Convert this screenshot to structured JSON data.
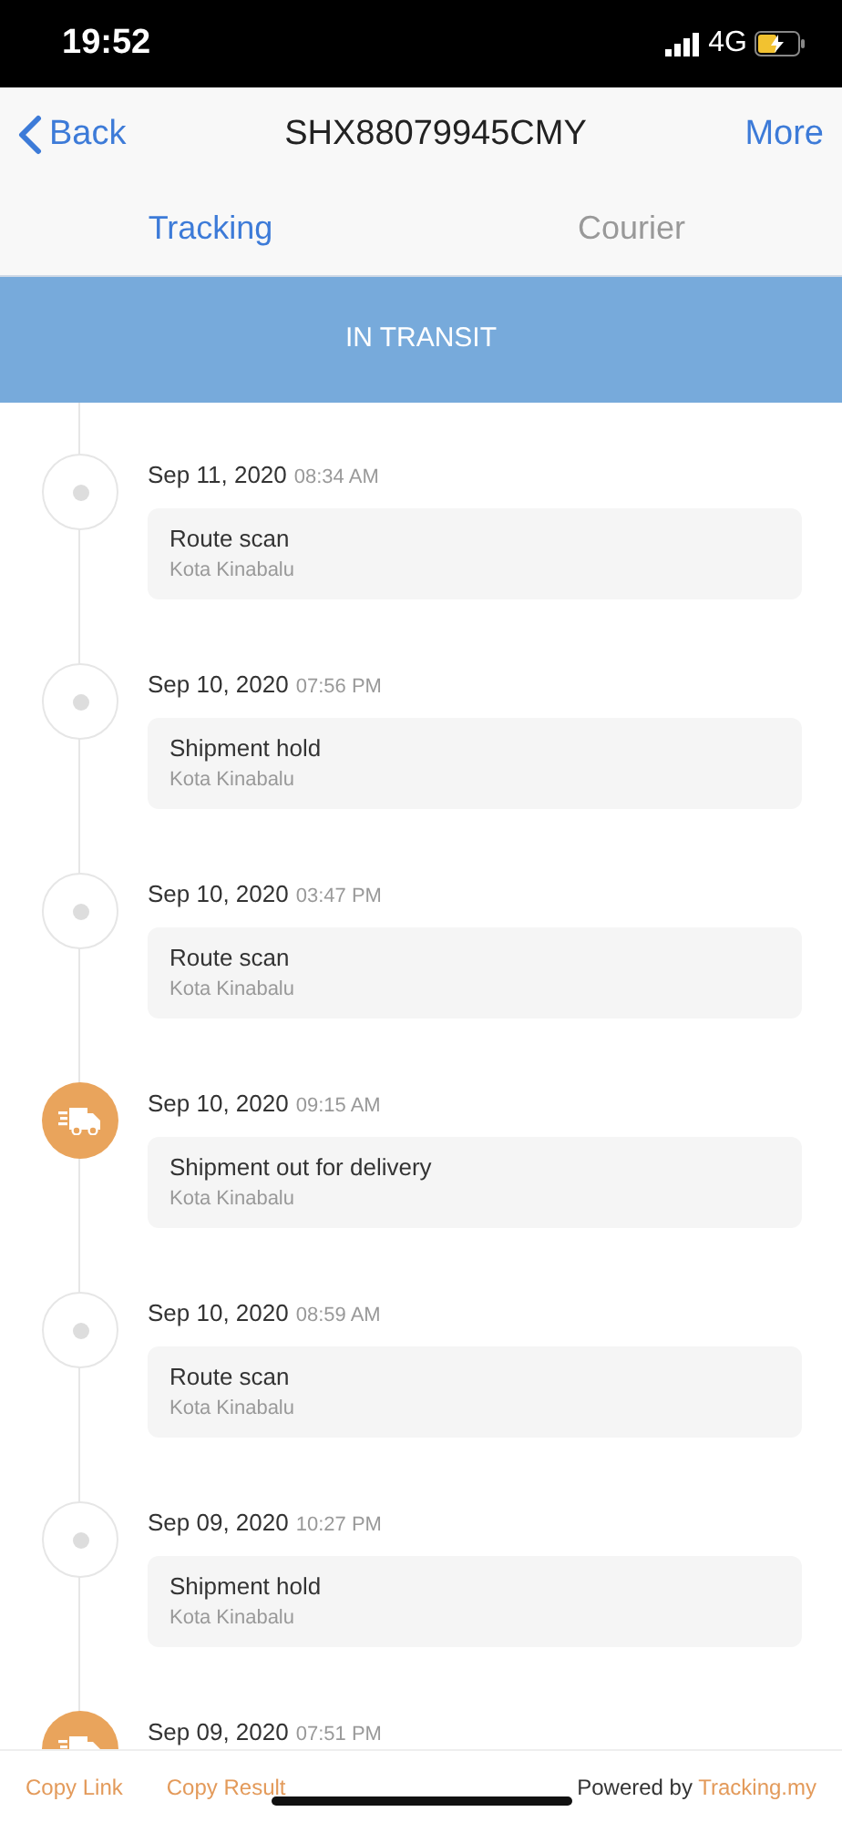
{
  "status_bar": {
    "time": "19:52",
    "network": "4G"
  },
  "nav": {
    "back": "Back",
    "title": "SHX88079945CMY",
    "more": "More"
  },
  "tabs": [
    {
      "label": "Tracking",
      "selected": true
    },
    {
      "label": "Courier",
      "selected": false
    }
  ],
  "status_banner": "IN TRANSIT",
  "events": [
    {
      "kind": "scan",
      "date": "Sep 11, 2020",
      "time": "08:34 AM",
      "title": "Route scan",
      "location": "Kota Kinabalu"
    },
    {
      "kind": "scan",
      "date": "Sep 10, 2020",
      "time": "07:56 PM",
      "title": "Shipment hold",
      "location": "Kota Kinabalu"
    },
    {
      "kind": "scan",
      "date": "Sep 10, 2020",
      "time": "03:47 PM",
      "title": "Route scan",
      "location": "Kota Kinabalu"
    },
    {
      "kind": "delivery",
      "date": "Sep 10, 2020",
      "time": "09:15 AM",
      "title": "Shipment out for delivery",
      "location": "Kota Kinabalu"
    },
    {
      "kind": "scan",
      "date": "Sep 10, 2020",
      "time": "08:59 AM",
      "title": "Route scan",
      "location": "Kota Kinabalu"
    },
    {
      "kind": "scan",
      "date": "Sep 09, 2020",
      "time": "10:27 PM",
      "title": "Shipment hold",
      "location": "Kota Kinabalu"
    },
    {
      "kind": "delivery",
      "date": "Sep 09, 2020",
      "time": "07:51 PM"
    }
  ],
  "footer": {
    "copy_link": "Copy Link",
    "copy_result": "Copy Result",
    "powered_by": "Powered by",
    "powered_link": "Tracking.my"
  }
}
